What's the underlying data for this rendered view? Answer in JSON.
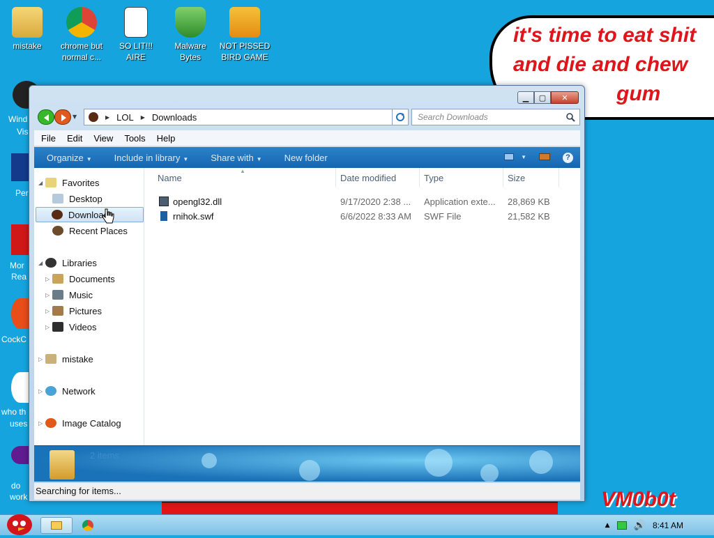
{
  "desktop": {
    "icons": [
      {
        "label": "mistake"
      },
      {
        "label": "chrome but normal c..."
      },
      {
        "label": "SO LIT!!! AIRE"
      },
      {
        "label": "Malware Bytes"
      },
      {
        "label": "NOT PISSED BIRD GAME"
      }
    ],
    "left_labels": [
      "Wind",
      "Vis",
      "Per",
      "Mor",
      "Rea",
      "CockC",
      "who th",
      "uses",
      "do",
      "work"
    ],
    "speech_lines": [
      "it's time to eat shit",
      "and die and chew",
      "gum"
    ],
    "brand": "VM0b0t"
  },
  "window": {
    "address": {
      "crumbs": [
        "LOL",
        "Downloads"
      ]
    },
    "search_placeholder": "Search Downloads",
    "menu": [
      "File",
      "Edit",
      "View",
      "Tools",
      "Help"
    ],
    "commands": {
      "organize": "Organize",
      "include": "Include in library",
      "share": "Share with",
      "new_folder": "New folder"
    },
    "nav": {
      "favorites": "Favorites",
      "desktop": "Desktop",
      "downloads": "Downloads",
      "recent": "Recent Places",
      "libraries": "Libraries",
      "documents": "Documents",
      "music": "Music",
      "pictures": "Pictures",
      "videos": "Videos",
      "mistake": "mistake",
      "network": "Network",
      "image_catalog": "Image Catalog"
    },
    "columns": {
      "name": "Name",
      "date": "Date modified",
      "type": "Type",
      "size": "Size"
    },
    "files": [
      {
        "name": "opengl32.dll",
        "date": "9/17/2020 2:38 ...",
        "type": "Application exte...",
        "size": "28,869 KB"
      },
      {
        "name": "rnihok.swf",
        "date": "6/6/2022 8:33 AM",
        "type": "SWF File",
        "size": "21,582 KB"
      }
    ],
    "details_count": "2 items",
    "status": "Searching for items..."
  },
  "taskbar": {
    "clock": "8:41 AM"
  },
  "colors": {
    "accent": "#1566b0",
    "desktop": "#16a4de",
    "alert_red": "#e0141b"
  }
}
